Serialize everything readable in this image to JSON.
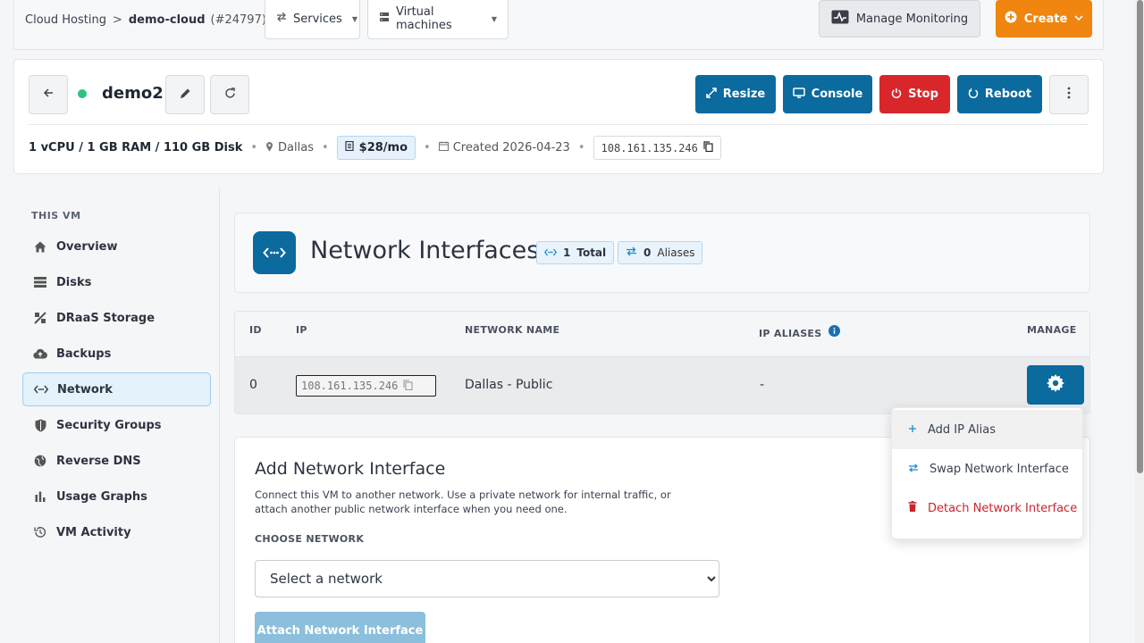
{
  "topbar": {
    "crumb_root": "Cloud Hosting",
    "crumb_sep": ">",
    "crumb_project": "demo-cloud",
    "crumb_id": "(#24797)",
    "services_label": "Services",
    "vms_label": "Virtual machines",
    "monitor_label": "Manage Monitoring",
    "create_label": "Create"
  },
  "vm": {
    "name": "demo2",
    "status_color": "#2ec27e",
    "actions": {
      "resize": "Resize",
      "console": "Console",
      "stop": "Stop",
      "reboot": "Reboot"
    },
    "specs": "1 vCPU / 1 GB RAM / 110 GB Disk",
    "location": "Dallas",
    "price": "$28/mo",
    "created": "Created 2026-04-23",
    "ip": "108.161.135.246"
  },
  "sidebar": {
    "title": "THIS VM",
    "items": [
      {
        "label": "Overview",
        "icon": "home-icon"
      },
      {
        "label": "Disks",
        "icon": "disks-icon"
      },
      {
        "label": "DRaaS Storage",
        "icon": "draas-icon"
      },
      {
        "label": "Backups",
        "icon": "cloud-upload-icon"
      },
      {
        "label": "Network",
        "icon": "network-icon"
      },
      {
        "label": "Security Groups",
        "icon": "shield-icon"
      },
      {
        "label": "Reverse DNS",
        "icon": "globe-icon"
      },
      {
        "label": "Usage Graphs",
        "icon": "bar-chart-icon"
      },
      {
        "label": "VM Activity",
        "icon": "history-icon"
      }
    ],
    "active": "Network"
  },
  "interfaces": {
    "title": "Network Interfaces",
    "total_count": "1",
    "total_label": "Total",
    "aliases_count": "0",
    "aliases_label": "Aliases",
    "columns": {
      "id": "ID",
      "ip": "IP",
      "network": "NETWORK NAME",
      "aliases": "IP ALIASES",
      "manage": "MANAGE"
    },
    "rows": [
      {
        "id": "0",
        "ip": "108.161.135.246",
        "network": "Dallas - Public",
        "aliases": "-"
      }
    ]
  },
  "menu": {
    "add_alias": "Add IP Alias",
    "swap": "Swap Network Interface",
    "detach": "Detach Network Interface"
  },
  "add_interface": {
    "title": "Add Network Interface",
    "description": "Connect this VM to another network. Use a private network for internal traffic, or attach another public network interface when you need one.",
    "choose_label": "CHOOSE NETWORK",
    "select_placeholder": "Select a network",
    "attach_label": "Attach Network Interface"
  },
  "colors": {
    "primary": "#0b6a9e",
    "create": "#f0850f",
    "stop": "#d9262b",
    "danger_text": "#c9252d"
  }
}
